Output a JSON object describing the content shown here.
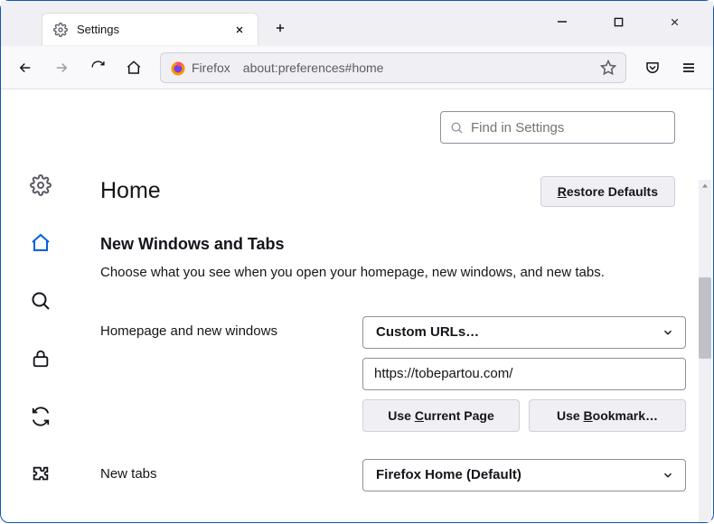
{
  "tab": {
    "label": "Settings"
  },
  "url": {
    "prefix": "Firefox",
    "path": "about:preferences#home"
  },
  "search": {
    "placeholder": "Find in Settings"
  },
  "page": {
    "title": "Home",
    "restore": "estore Defaults",
    "restoreKey": "R"
  },
  "section": {
    "heading": "New Windows and Tabs",
    "desc": "Choose what you see when you open your homepage, new windows, and new tabs."
  },
  "homepage": {
    "label": "Homepage and new windows",
    "select": "Custom URLs…",
    "url": "https://tobepartou.com/",
    "useCurrentKey": "C",
    "useCurrentRest": "urrent Page",
    "useCurrentPre": "Use ",
    "useBookmarkKey": "B",
    "useBookmarkPre": "Use ",
    "useBookmarkRest": "ookmark…"
  },
  "newtabs": {
    "label": "New tabs",
    "select": "Firefox Home (Default)"
  }
}
